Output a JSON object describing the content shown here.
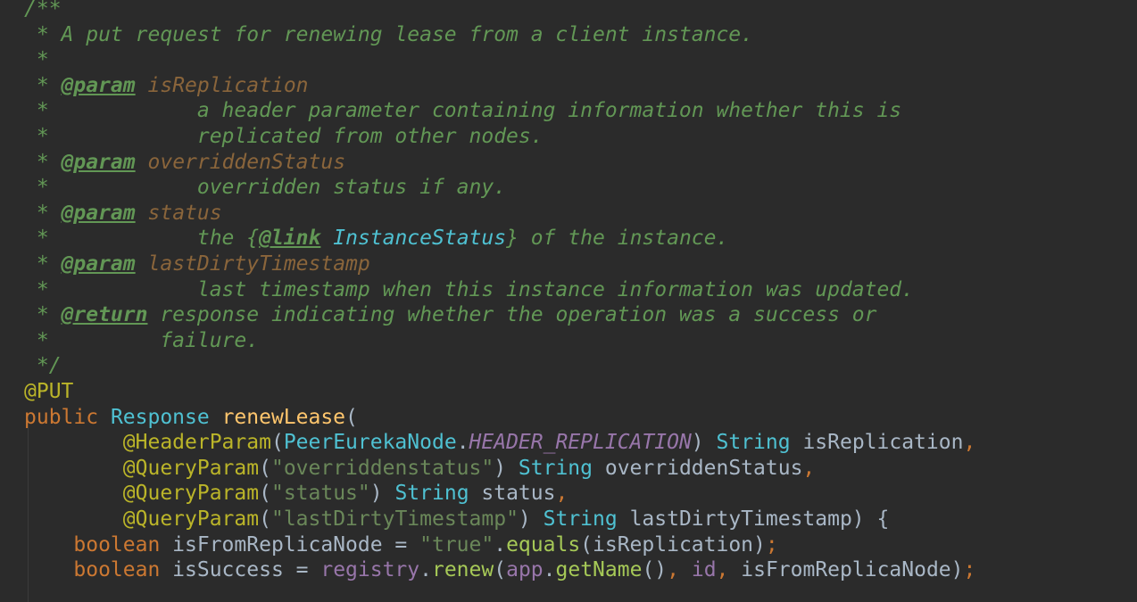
{
  "editor": {
    "language": "Java",
    "code_lines": [
      [
        [
          "doc",
          "/**"
        ]
      ],
      [
        [
          "doc",
          " * A put request for renewing lease from a client instance."
        ]
      ],
      [
        [
          "doc",
          " *"
        ]
      ],
      [
        [
          "doc",
          " * "
        ],
        [
          "tag",
          "@param"
        ],
        [
          "doc",
          " "
        ],
        [
          "pname",
          "isReplication"
        ]
      ],
      [
        [
          "doc",
          " *            a header parameter containing information whether this is"
        ]
      ],
      [
        [
          "doc",
          " *            replicated from other nodes."
        ]
      ],
      [
        [
          "doc",
          " * "
        ],
        [
          "tag",
          "@param"
        ],
        [
          "doc",
          " "
        ],
        [
          "pname",
          "overriddenStatus"
        ]
      ],
      [
        [
          "doc",
          " *            overridden status if any."
        ]
      ],
      [
        [
          "doc",
          " * "
        ],
        [
          "tag",
          "@param"
        ],
        [
          "doc",
          " "
        ],
        [
          "pname",
          "status"
        ]
      ],
      [
        [
          "doc",
          " *            the {"
        ],
        [
          "tag",
          "@link"
        ],
        [
          "doc",
          " "
        ],
        [
          "linkref",
          "InstanceStatus"
        ],
        [
          "doc",
          "} of the instance."
        ]
      ],
      [
        [
          "doc",
          " * "
        ],
        [
          "tag",
          "@param"
        ],
        [
          "doc",
          " "
        ],
        [
          "pname",
          "lastDirtyTimestamp"
        ]
      ],
      [
        [
          "doc",
          " *            last timestamp when this instance information was updated."
        ]
      ],
      [
        [
          "doc",
          " * "
        ],
        [
          "tag",
          "@return"
        ],
        [
          "doc",
          " response indicating whether the operation was a success or"
        ]
      ],
      [
        [
          "doc",
          " *         failure."
        ]
      ],
      [
        [
          "doc",
          " */"
        ]
      ],
      [
        [
          "ann",
          "@PUT"
        ]
      ],
      [
        [
          "kw",
          "public "
        ],
        [
          "type",
          "Response "
        ],
        [
          "method",
          "renewLease"
        ],
        [
          "plain",
          "("
        ]
      ],
      [
        [
          "plain",
          "        "
        ],
        [
          "ann",
          "@HeaderParam"
        ],
        [
          "plain",
          "("
        ],
        [
          "type",
          "PeerEurekaNode"
        ],
        [
          "plain",
          "."
        ],
        [
          "const",
          "HEADER_REPLICATION"
        ],
        [
          "plain",
          ") "
        ],
        [
          "type",
          "String "
        ],
        [
          "plain",
          "isReplication"
        ],
        [
          "punct",
          ","
        ]
      ],
      [
        [
          "plain",
          "        "
        ],
        [
          "ann",
          "@QueryParam"
        ],
        [
          "plain",
          "("
        ],
        [
          "str",
          "\"overriddenstatus\""
        ],
        [
          "plain",
          ") "
        ],
        [
          "type",
          "String "
        ],
        [
          "plain",
          "overriddenStatus"
        ],
        [
          "punct",
          ","
        ]
      ],
      [
        [
          "plain",
          "        "
        ],
        [
          "ann",
          "@QueryParam"
        ],
        [
          "plain",
          "("
        ],
        [
          "str",
          "\"status\""
        ],
        [
          "plain",
          ") "
        ],
        [
          "type",
          "String "
        ],
        [
          "plain",
          "status"
        ],
        [
          "punct",
          ","
        ]
      ],
      [
        [
          "plain",
          "        "
        ],
        [
          "ann",
          "@QueryParam"
        ],
        [
          "plain",
          "("
        ],
        [
          "str",
          "\"lastDirtyTimestamp\""
        ],
        [
          "plain",
          ") "
        ],
        [
          "type",
          "String "
        ],
        [
          "plain",
          "lastDirtyTimestamp) {"
        ]
      ],
      [
        [
          "plain",
          "    "
        ],
        [
          "kw",
          "boolean "
        ],
        [
          "plain",
          "isFromReplicaNode = "
        ],
        [
          "str",
          "\"true\""
        ],
        [
          "plain",
          "."
        ],
        [
          "call",
          "equals"
        ],
        [
          "plain",
          "(isReplication)"
        ],
        [
          "punct",
          ";"
        ]
      ],
      [
        [
          "plain",
          "    "
        ],
        [
          "kw",
          "boolean "
        ],
        [
          "plain",
          "isSuccess = "
        ],
        [
          "field",
          "registry"
        ],
        [
          "plain",
          "."
        ],
        [
          "call",
          "renew"
        ],
        [
          "plain",
          "("
        ],
        [
          "field",
          "app"
        ],
        [
          "plain",
          "."
        ],
        [
          "call",
          "getName"
        ],
        [
          "plain",
          "()"
        ],
        [
          "punct",
          ", "
        ],
        [
          "field",
          "id"
        ],
        [
          "punct",
          ", "
        ],
        [
          "plain",
          "isFromReplicaNode)"
        ],
        [
          "punct",
          ";"
        ]
      ]
    ]
  }
}
